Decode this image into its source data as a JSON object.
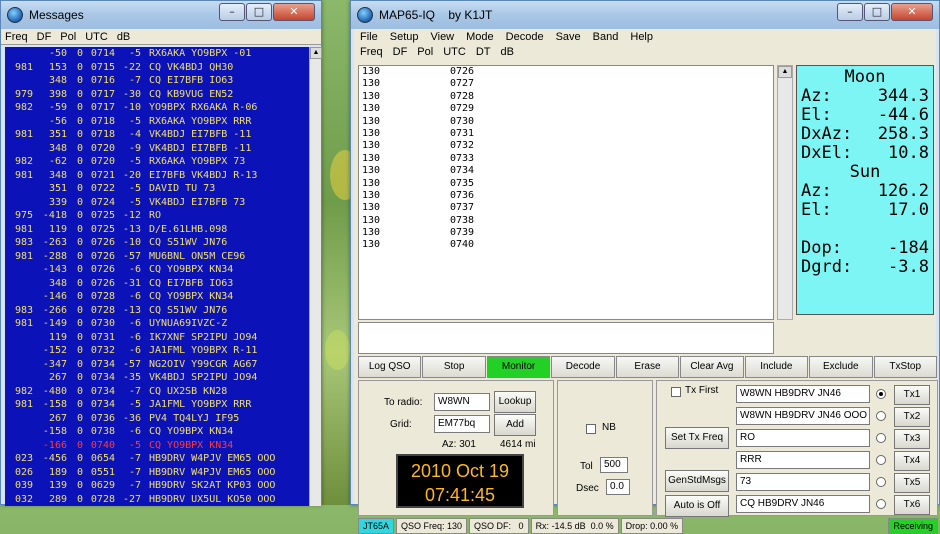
{
  "messages_window": {
    "title": "Messages",
    "columns": [
      "Freq",
      "DF",
      "Pol",
      "UTC",
      "dB"
    ],
    "rows": [
      {
        "freq": "",
        "df": "-50",
        "pol": "0",
        "utc": "0714",
        "db": "-5",
        "msg": "RX6AKA YO9BPX -01",
        "red": false
      },
      {
        "freq": "981",
        "df": "153",
        "pol": "0",
        "utc": "0715",
        "db": "-22",
        "msg": "CQ VK4BDJ QH30",
        "red": false
      },
      {
        "freq": "",
        "df": "348",
        "pol": "0",
        "utc": "0716",
        "db": "-7",
        "msg": "CQ EI7BFB IO63",
        "red": false
      },
      {
        "freq": "979",
        "df": "398",
        "pol": "0",
        "utc": "0717",
        "db": "-30",
        "msg": "CQ KB9VUG EN52",
        "red": false
      },
      {
        "freq": "982",
        "df": "-59",
        "pol": "0",
        "utc": "0717",
        "db": "-10",
        "msg": "YO9BPX RX6AKA R-06",
        "red": false
      },
      {
        "freq": "",
        "df": "-56",
        "pol": "0",
        "utc": "0718",
        "db": "-5",
        "msg": "RX6AKA YO9BPX RRR",
        "red": false
      },
      {
        "freq": "981",
        "df": "351",
        "pol": "0",
        "utc": "0718",
        "db": "-4",
        "msg": "VK4BDJ EI7BFB -11",
        "red": false
      },
      {
        "freq": "",
        "df": "348",
        "pol": "0",
        "utc": "0720",
        "db": "-9",
        "msg": "VK4BDJ EI7BFB -11",
        "red": false
      },
      {
        "freq": "982",
        "df": "-62",
        "pol": "0",
        "utc": "0720",
        "db": "-5",
        "msg": "RX6AKA YO9BPX 73",
        "red": false
      },
      {
        "freq": "981",
        "df": "348",
        "pol": "0",
        "utc": "0721",
        "db": "-20",
        "msg": "EI7BFB VK4BDJ R-13",
        "red": false
      },
      {
        "freq": "",
        "df": "351",
        "pol": "0",
        "utc": "0722",
        "db": "-5",
        "msg": "DAVID TU 73",
        "red": false
      },
      {
        "freq": "",
        "df": "339",
        "pol": "0",
        "utc": "0724",
        "db": "-5",
        "msg": "VK4BDJ EI7BFB 73",
        "red": false
      },
      {
        "freq": "975",
        "df": "-418",
        "pol": "0",
        "utc": "0725",
        "db": "-12",
        "msg": "RO",
        "red": false
      },
      {
        "freq": "981",
        "df": "119",
        "pol": "0",
        "utc": "0725",
        "db": "-13",
        "msg": "D/E.61LHB.098",
        "red": false
      },
      {
        "freq": "983",
        "df": "-263",
        "pol": "0",
        "utc": "0726",
        "db": "-10",
        "msg": "CQ S51WV JN76",
        "red": false
      },
      {
        "freq": "981",
        "df": "-288",
        "pol": "0",
        "utc": "0726",
        "db": "-57",
        "msg": "MU6BNL ON5M CE96",
        "red": false
      },
      {
        "freq": "",
        "df": "-143",
        "pol": "0",
        "utc": "0726",
        "db": "-6",
        "msg": "CQ YO9BPX KN34",
        "red": false
      },
      {
        "freq": "",
        "df": "348",
        "pol": "0",
        "utc": "0726",
        "db": "-31",
        "msg": "CQ EI7BFB IO63",
        "red": false
      },
      {
        "freq": "",
        "df": "-146",
        "pol": "0",
        "utc": "0728",
        "db": "-6",
        "msg": "CQ YO9BPX KN34",
        "red": false
      },
      {
        "freq": "983",
        "df": "-266",
        "pol": "0",
        "utc": "0728",
        "db": "-13",
        "msg": "CQ S51WV JN76",
        "red": false
      },
      {
        "freq": "981",
        "df": "-149",
        "pol": "0",
        "utc": "0730",
        "db": "-6",
        "msg": "UYNUA69IVZC-Z",
        "red": false
      },
      {
        "freq": "",
        "df": "119",
        "pol": "0",
        "utc": "0731",
        "db": "-6",
        "msg": "IK7XNF SP2IPU JO94",
        "red": false
      },
      {
        "freq": "",
        "df": "-152",
        "pol": "0",
        "utc": "0732",
        "db": "-6",
        "msg": "JA1FML YO9BPX R-11",
        "red": false
      },
      {
        "freq": "",
        "df": "-347",
        "pol": "0",
        "utc": "0734",
        "db": "-57",
        "msg": "NG2OIV Y99CGR AG67",
        "red": false
      },
      {
        "freq": "",
        "df": "267",
        "pol": "0",
        "utc": "0734",
        "db": "-35",
        "msg": "VK4BDJ SP2IPU JO94",
        "red": false
      },
      {
        "freq": "982",
        "df": "-480",
        "pol": "0",
        "utc": "0734",
        "db": "-7",
        "msg": "CQ UX2SB KN28",
        "red": false
      },
      {
        "freq": "981",
        "df": "-158",
        "pol": "0",
        "utc": "0734",
        "db": "-5",
        "msg": "JA1FML YO9BPX RRR",
        "red": false
      },
      {
        "freq": "",
        "df": "267",
        "pol": "0",
        "utc": "0736",
        "db": "-36",
        "msg": "PV4 TQ4LYJ IF95",
        "red": false
      },
      {
        "freq": "",
        "df": "-158",
        "pol": "0",
        "utc": "0738",
        "db": "-6",
        "msg": "CQ YO9BPX KN34",
        "red": false
      },
      {
        "freq": "",
        "df": "-166",
        "pol": "0",
        "utc": "0740",
        "db": "-5",
        "msg": "CQ YO9BPX KN34",
        "red": true
      },
      {
        "freq": "023",
        "df": "-456",
        "pol": "0",
        "utc": "0654",
        "db": "-7",
        "msg": "HB9DRV W4PJV EM65 OOO",
        "red": false
      },
      {
        "freq": "026",
        "df": "189",
        "pol": "0",
        "utc": "0551",
        "db": "-7",
        "msg": "HB9DRV W4PJV EM65 OOO",
        "red": false
      },
      {
        "freq": "039",
        "df": "139",
        "pol": "0",
        "utc": "0629",
        "db": "-7",
        "msg": "HB9DRV SK2AT KP03 OOO",
        "red": false
      },
      {
        "freq": "032",
        "df": "289",
        "pol": "0",
        "utc": "0728",
        "db": "-27",
        "msg": "HB9DRV UX5UL KO50 OOO",
        "red": false
      }
    ]
  },
  "map_window": {
    "title": "MAP65-IQ    by K1JT",
    "menu": [
      "File",
      "Setup",
      "View",
      "Mode",
      "Decode",
      "Save",
      "Band",
      "Help"
    ],
    "columns": [
      "Freq",
      "DF",
      "Pol",
      "UTC",
      "DT",
      "dB"
    ],
    "rows": [
      {
        "freq": "130",
        "utc": "0726"
      },
      {
        "freq": "130",
        "utc": "0727"
      },
      {
        "freq": "130",
        "utc": "0728"
      },
      {
        "freq": "130",
        "utc": "0729"
      },
      {
        "freq": "130",
        "utc": "0730"
      },
      {
        "freq": "130",
        "utc": "0731"
      },
      {
        "freq": "130",
        "utc": "0732"
      },
      {
        "freq": "130",
        "utc": "0733"
      },
      {
        "freq": "130",
        "utc": "0734"
      },
      {
        "freq": "130",
        "utc": "0735"
      },
      {
        "freq": "130",
        "utc": "0736"
      },
      {
        "freq": "130",
        "utc": "0737"
      },
      {
        "freq": "130",
        "utc": "0738"
      },
      {
        "freq": "130",
        "utc": "0739"
      },
      {
        "freq": "130",
        "utc": "0740"
      }
    ],
    "astro": {
      "moon_label": "Moon",
      "az_label": "Az:",
      "moon_az": "344.3",
      "el_label": "El:",
      "moon_el": "-44.6",
      "dxaz_label": "DxAz:",
      "dxaz": "258.3",
      "dxel_label": "DxEl:",
      "dxel": "10.8",
      "sun_label": "Sun",
      "sun_az": "126.2",
      "sun_el": "17.0",
      "dop_label": "Dop:",
      "dop": "-184",
      "dgrd_label": "Dgrd:",
      "dgrd": "-3.8"
    },
    "buttons": {
      "log_qso": "Log QSO",
      "stop": "Stop",
      "monitor": "Monitor",
      "decode": "Decode",
      "erase": "Erase",
      "clear_avg": "Clear Avg",
      "include": "Include",
      "exclude": "Exclude",
      "txstop": "TxStop"
    },
    "station": {
      "to_radio_label": "To radio:",
      "to_radio": "W8WN",
      "lookup": "Lookup",
      "grid_label": "Grid:",
      "grid": "EM77bq",
      "add": "Add",
      "az": "Az: 301",
      "dist": "4614 mi",
      "date": "2010 Oct 19",
      "time": "07:41:45"
    },
    "mid": {
      "nb_label": "NB",
      "tol_label": "Tol",
      "tol": "500",
      "dsec_label": "Dsec",
      "dsec": "0.0"
    },
    "tx": {
      "tx_first": "Tx First",
      "set_tx_freq": "Set Tx Freq",
      "gen_std_msgs": "GenStdMsgs",
      "auto": "Auto is Off",
      "messages": [
        "W8WN HB9DRV JN46",
        "W8WN HB9DRV JN46 OOO",
        "RO",
        "RRR",
        "73",
        "CQ HB9DRV JN46"
      ],
      "labels": [
        "Tx1",
        "Tx2",
        "Tx3",
        "Tx4",
        "Tx5",
        "Tx6"
      ]
    },
    "status": {
      "mode": "JT65A",
      "qso_freq": "QSO Freq: 130",
      "qso_df": "QSO DF:   0",
      "rx": "Rx: -14.5 dB  0.0 %",
      "drop": "Drop: 0.00 %",
      "state": "Receiving"
    }
  }
}
